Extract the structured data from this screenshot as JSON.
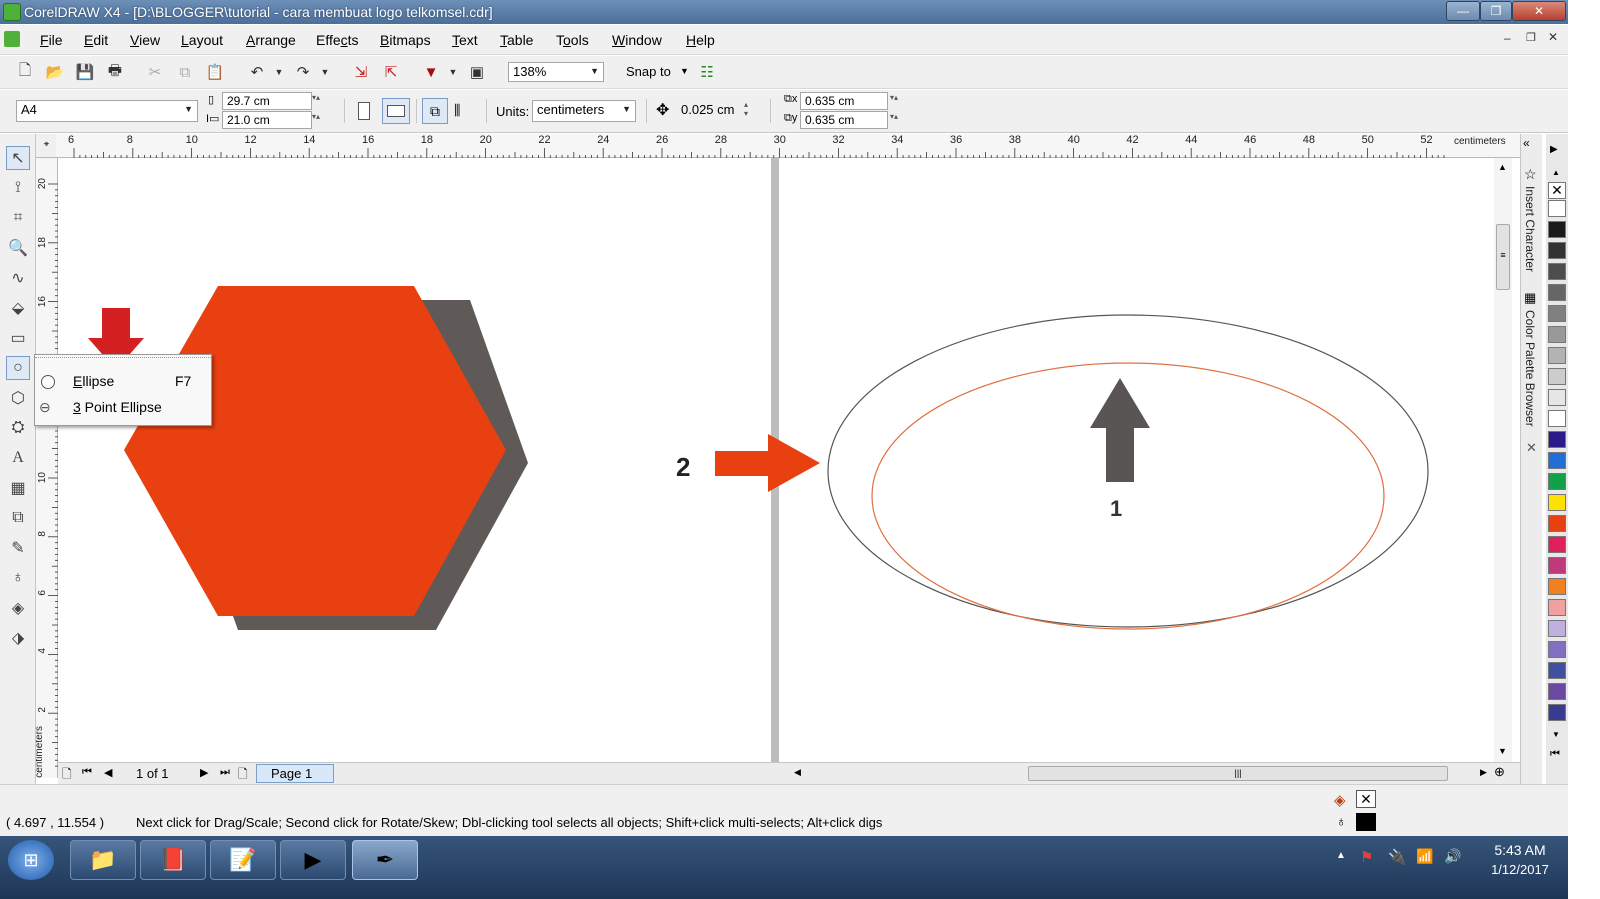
{
  "window": {
    "title": "CorelDRAW X4 - [D:\\BLOGGER\\tutorial - cara membuat logo telkomsel.cdr]",
    "minimize": "—",
    "maximize": "❐",
    "close": "✕"
  },
  "menu": [
    {
      "pre": "",
      "u": "F",
      "post": "ile"
    },
    {
      "pre": "",
      "u": "E",
      "post": "dit"
    },
    {
      "pre": "",
      "u": "V",
      "post": "iew"
    },
    {
      "pre": "",
      "u": "L",
      "post": "ayout"
    },
    {
      "pre": "",
      "u": "A",
      "post": "rrange"
    },
    {
      "pre": "Effe",
      "u": "c",
      "post": "ts"
    },
    {
      "pre": "",
      "u": "B",
      "post": "itmaps"
    },
    {
      "pre": "",
      "u": "T",
      "post": "ext"
    },
    {
      "pre": "",
      "u": "T",
      "post": "able"
    },
    {
      "pre": "T",
      "u": "o",
      "post": "ols"
    },
    {
      "pre": "",
      "u": "W",
      "post": "indow"
    },
    {
      "pre": "",
      "u": "H",
      "post": "elp"
    }
  ],
  "toolbar": {
    "zoom": "138%",
    "snap_label": "Snap to"
  },
  "property_bar": {
    "paper": "A4",
    "width": "29.7 cm",
    "height": "21.0 cm",
    "units_label": "Units:",
    "units_value": "centimeters",
    "nudge": "0.025 cm",
    "dup_x": "0.635 cm",
    "dup_y": "0.635 cm"
  },
  "ruler": {
    "top_ticks": [
      "6",
      "8",
      "10",
      "12",
      "14",
      "16",
      "18",
      "20",
      "22",
      "24",
      "26",
      "28",
      "30",
      "32",
      "34",
      "36",
      "38",
      "40",
      "42",
      "44",
      "46",
      "48",
      "50",
      "52"
    ],
    "top_unit": "centimeters",
    "left_ticks": [
      "20",
      "18",
      "16",
      "14",
      "12",
      "10",
      "8",
      "6",
      "4",
      "2"
    ],
    "left_unit": "centimeters"
  },
  "flyout": {
    "items": [
      {
        "label_u": "E",
        "label_rest": "llipse",
        "shortcut": "F7"
      },
      {
        "label_u": "3",
        "label_rest": " Point Ellipse",
        "shortcut": ""
      }
    ]
  },
  "annotations": {
    "step2": "2",
    "step1": "1"
  },
  "colors": {
    "hexagon": "#e84010",
    "shadow": "#5f5a58",
    "arrow_red": "#d42020",
    "arrow_orange": "#e84010",
    "arrow_gray": "#5a5555",
    "ellipse_inner": "#e07040",
    "ellipse_outer": "#555555"
  },
  "dock": {
    "insert_character": "Insert Character",
    "color_palette_browser": "Color Palette Browser"
  },
  "page_nav": {
    "count": "1 of 1",
    "tab": "Page 1"
  },
  "status": {
    "coords": "( 4.697 , 11.554 )",
    "hint": "Next click for Drag/Scale; Second click for Rotate/Skew; Dbl-clicking tool selects all objects; Shift+click multi-selects; Alt+click digs"
  },
  "palette": [
    "#ffffff",
    "#1a1a1a",
    "#333333",
    "#4d4d4d",
    "#666666",
    "#808080",
    "#999999",
    "#b3b3b3",
    "#cccccc",
    "#e6e6e6",
    "#ffffff",
    "#2b1a8a",
    "#1f6fd6",
    "#12a04a",
    "#ffe000",
    "#e84010",
    "#e0205a",
    "#c03a7a",
    "#f08020",
    "#f0a0a0",
    "#c0b0e0",
    "#8070c0",
    "#4050a0",
    "#6a4aa0",
    "#3a3a90"
  ],
  "taskbar": {
    "time": "5:43 AM",
    "date": "1/12/2017"
  }
}
